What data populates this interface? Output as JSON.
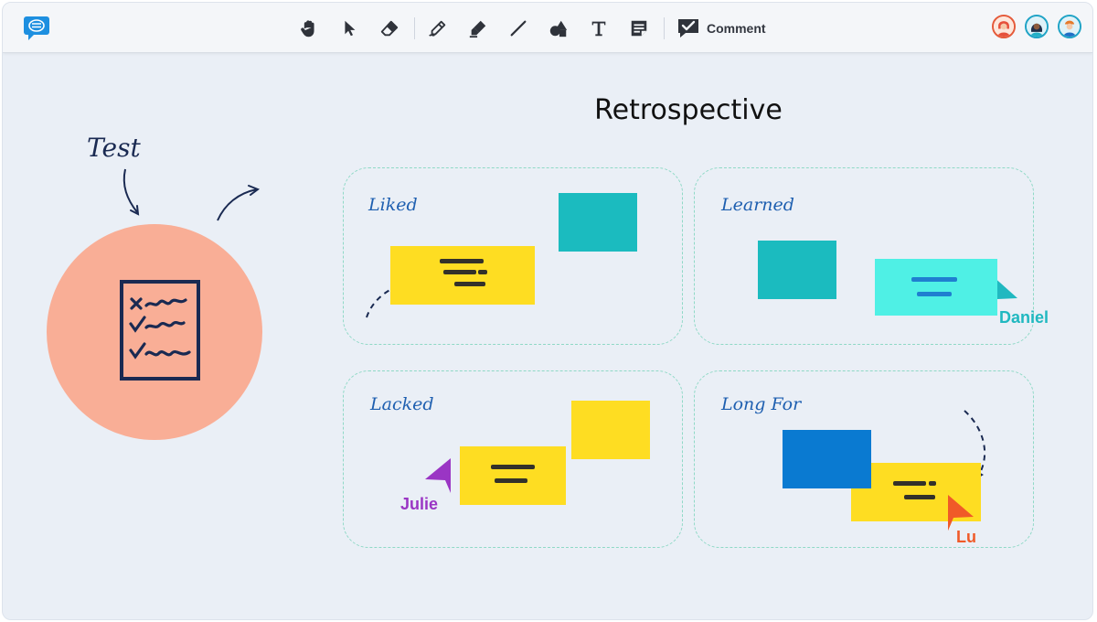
{
  "toolbar": {
    "logo_icon": "chat-logo-icon",
    "tools": [
      "hand-icon",
      "pointer-icon",
      "eraser-icon",
      "pen-icon",
      "highlighter-icon",
      "line-icon",
      "shapes-icon",
      "text-icon",
      "sticky-note-icon"
    ],
    "comment_label": "Comment"
  },
  "users": [
    "user-1",
    "user-2",
    "user-3"
  ],
  "board": {
    "title": "Retrospective",
    "test_label": "Test",
    "zones": {
      "liked": "Liked",
      "learned": "Learned",
      "lacked": "Lacked",
      "long_for": "Long For"
    },
    "cursors": {
      "daniel": "Daniel",
      "julie": "Julie",
      "lu": "Lu"
    }
  },
  "colors": {
    "teal": "#1bbbbf",
    "cyan": "#4ff0e5",
    "yellow": "#fedd22",
    "blue": "#0a7ad1",
    "salmon": "#f9ae96",
    "julie": "#9a35c4",
    "lu": "#f05a28",
    "daniel": "#20b8c0"
  }
}
